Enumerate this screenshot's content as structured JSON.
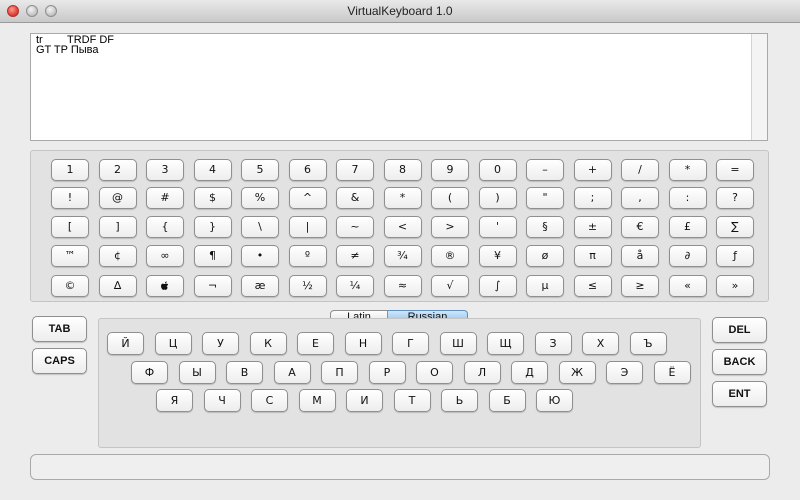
{
  "window": {
    "title": "VirtualKeyboard 1.0"
  },
  "text_area": {
    "line1": "tr        TRDF DF",
    "line2": "GT TP Пыва"
  },
  "symbols": [
    [
      "1",
      "2",
      "3",
      "4",
      "5",
      "6",
      "7",
      "8",
      "9",
      "0",
      "–",
      "+",
      "/",
      "*",
      "="
    ],
    [
      "!",
      "@",
      "#",
      "$",
      "%",
      "^",
      "&",
      "*",
      "(",
      ")",
      "\"",
      ";",
      ",",
      ":",
      "?"
    ],
    [
      "[",
      "]",
      "{",
      "}",
      "\\",
      "|",
      "~",
      "<",
      ">",
      "'",
      "§",
      "±",
      "€",
      "£",
      "∑"
    ],
    [
      "™",
      "¢",
      "∞",
      "¶",
      "•",
      "º",
      "≠",
      "¾",
      "®",
      "¥",
      "ø",
      "π",
      "å",
      "∂",
      "ƒ"
    ],
    [
      "©",
      "∆",
      "",
      "¬",
      "æ",
      "½",
      "¼",
      "≈",
      "√",
      "∫",
      "µ",
      "≤",
      "≥",
      "«",
      "»"
    ]
  ],
  "tabs": {
    "latin": "Latin",
    "russian": "Russian",
    "active": "Russian"
  },
  "russian_rows": [
    [
      "Й",
      "Ц",
      "У",
      "К",
      "Е",
      "Н",
      "Г",
      "Ш",
      "Щ",
      "З",
      "Х",
      "Ъ"
    ],
    [
      "Ф",
      "Ы",
      "В",
      "А",
      "П",
      "Р",
      "О",
      "Л",
      "Д",
      "Ж",
      "Э",
      "Ё"
    ],
    [
      "Я",
      "Ч",
      "С",
      "М",
      "И",
      "Т",
      "Ь",
      "Б",
      "Ю"
    ]
  ],
  "side_keys": {
    "tab": "TAB",
    "caps": "CAPS",
    "del": "DEL",
    "back": "BACK",
    "ent": "ENT"
  },
  "status_bar": {
    "text": ""
  }
}
